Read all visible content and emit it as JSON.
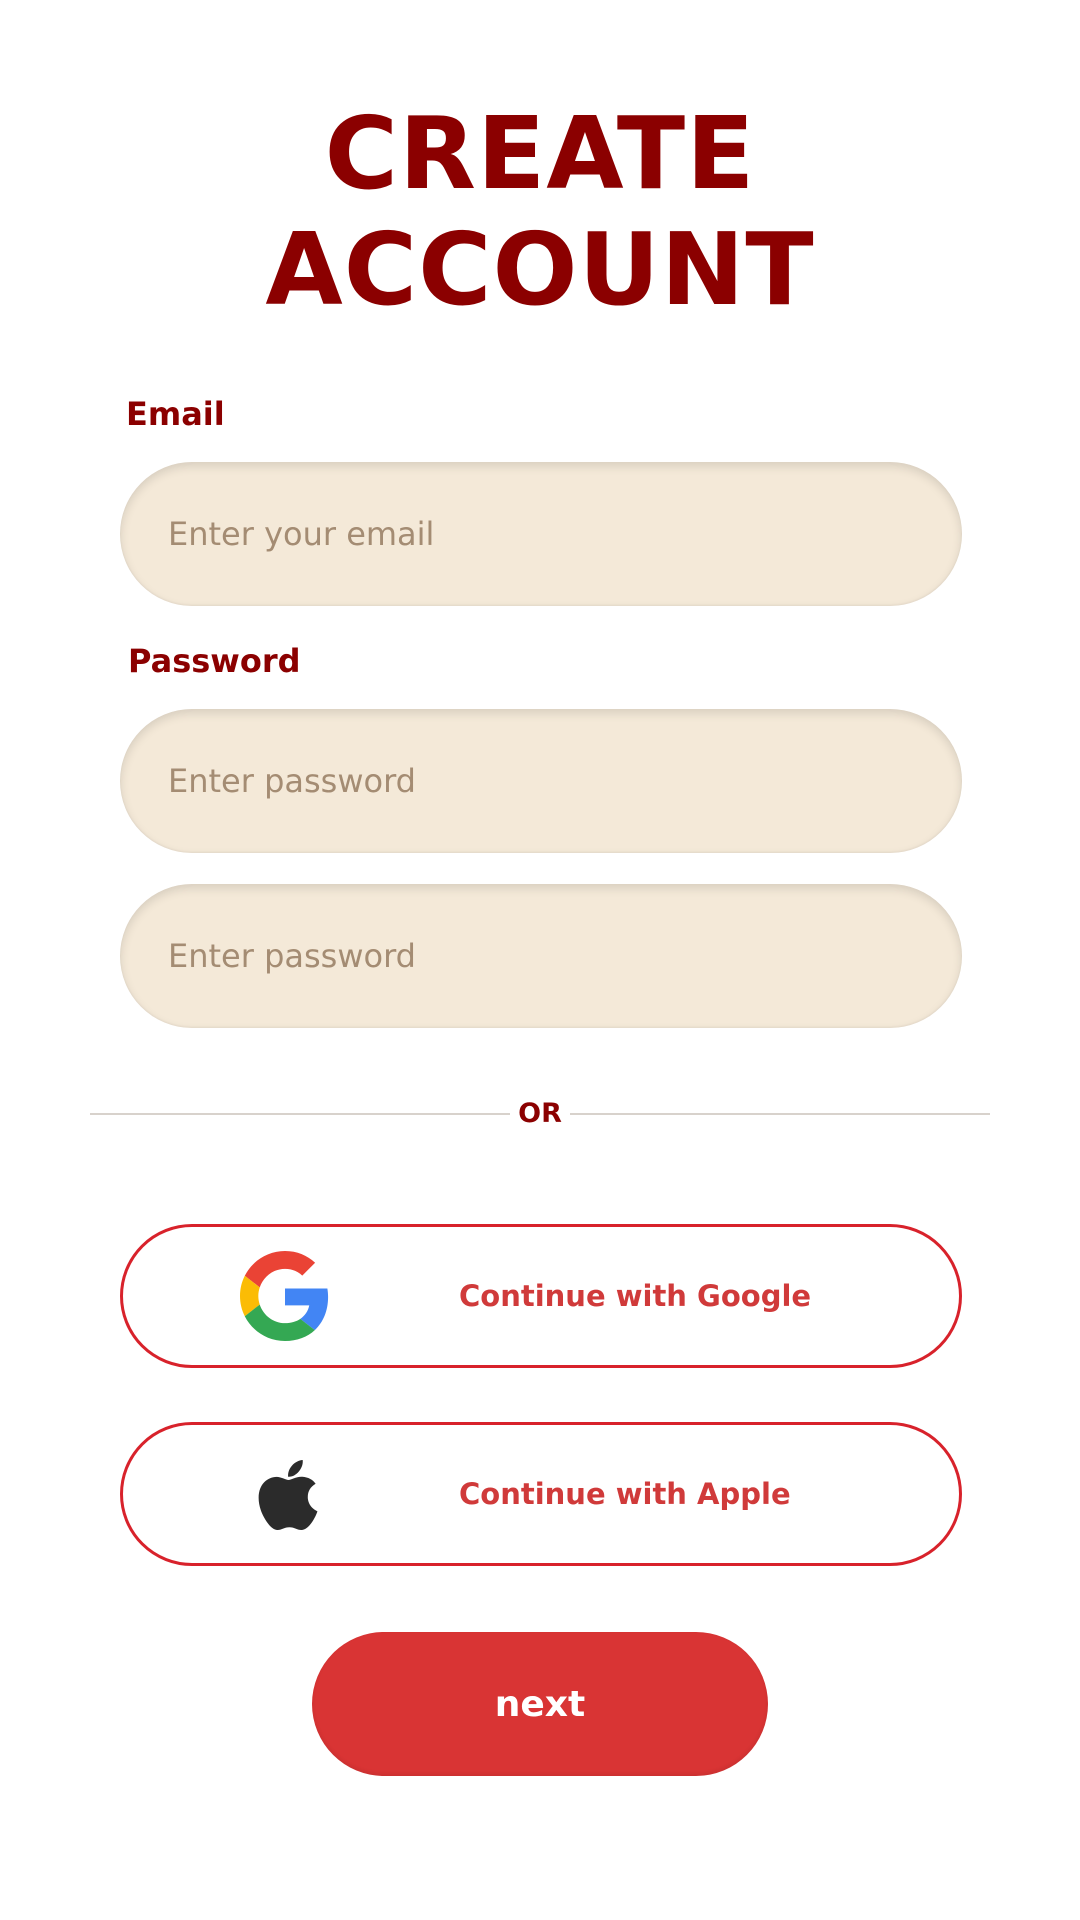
{
  "header": {
    "title": "CREATE\nACCOUNT"
  },
  "form": {
    "email": {
      "label": "Email",
      "placeholder": "Enter your email",
      "value": ""
    },
    "password": {
      "label": "Password",
      "placeholder": "Enter password",
      "value": ""
    },
    "confirm_password": {
      "placeholder": "Enter password",
      "value": ""
    }
  },
  "divider": {
    "text": "OR"
  },
  "social": {
    "google": {
      "label": "Continue with Google",
      "icon": "google-icon"
    },
    "apple": {
      "label": "Continue with Apple",
      "icon": "apple-icon"
    }
  },
  "actions": {
    "next_label": "next"
  },
  "colors": {
    "accent_dark_red": "#8b0000",
    "accent_red": "#d93434",
    "button_border": "#d8222b",
    "input_background": "#f4e9d8",
    "page_background": "#ffffff"
  }
}
